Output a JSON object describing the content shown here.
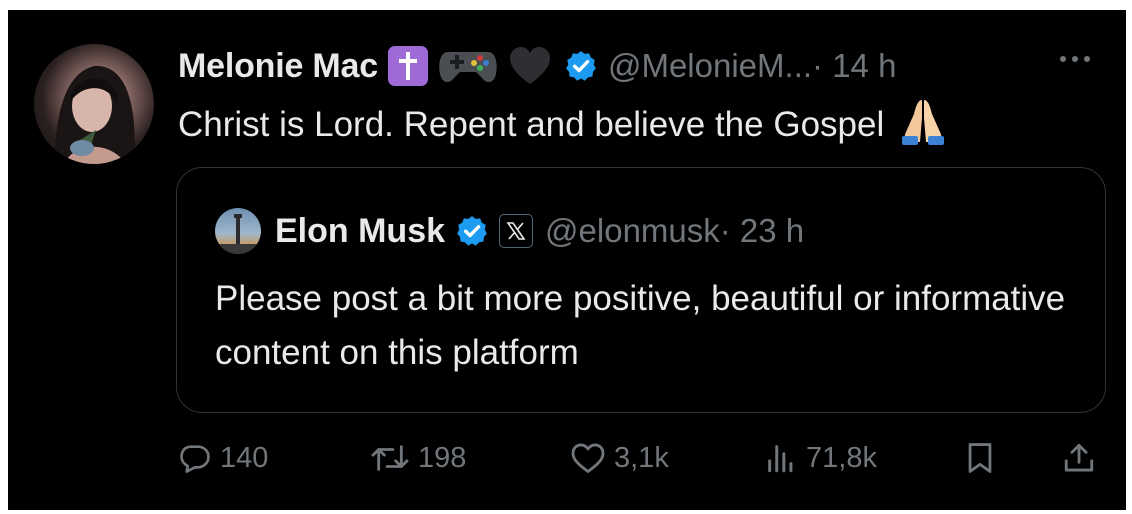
{
  "author": {
    "name": "Melonie Mac",
    "handle": "@MelonieM...",
    "time": "· 14 h",
    "badges": [
      "latin-cross-emoji",
      "video-game-emoji",
      "black-heart-emoji",
      "verified-badge-icon"
    ]
  },
  "tweet": {
    "text": "Christ is Lord. Repent and believe the Gospel",
    "trailing_emoji": "folded-hands-emoji"
  },
  "quoted": {
    "name": "Elon Musk",
    "handle": "@elonmusk",
    "time": "· 23 h",
    "badges": [
      "verified-badge-icon",
      "x-affiliate-icon"
    ],
    "text": "Please post a bit more positive, beautiful or informative content on this platform"
  },
  "actions": {
    "replies": "140",
    "reposts": "198",
    "likes": "3,1k",
    "views": "71,8k"
  },
  "colors": {
    "background": "#000000",
    "primary_text": "#e7e9ea",
    "secondary_text": "#71767b",
    "verified": "#1d9bf0",
    "border": "#2f3336"
  }
}
